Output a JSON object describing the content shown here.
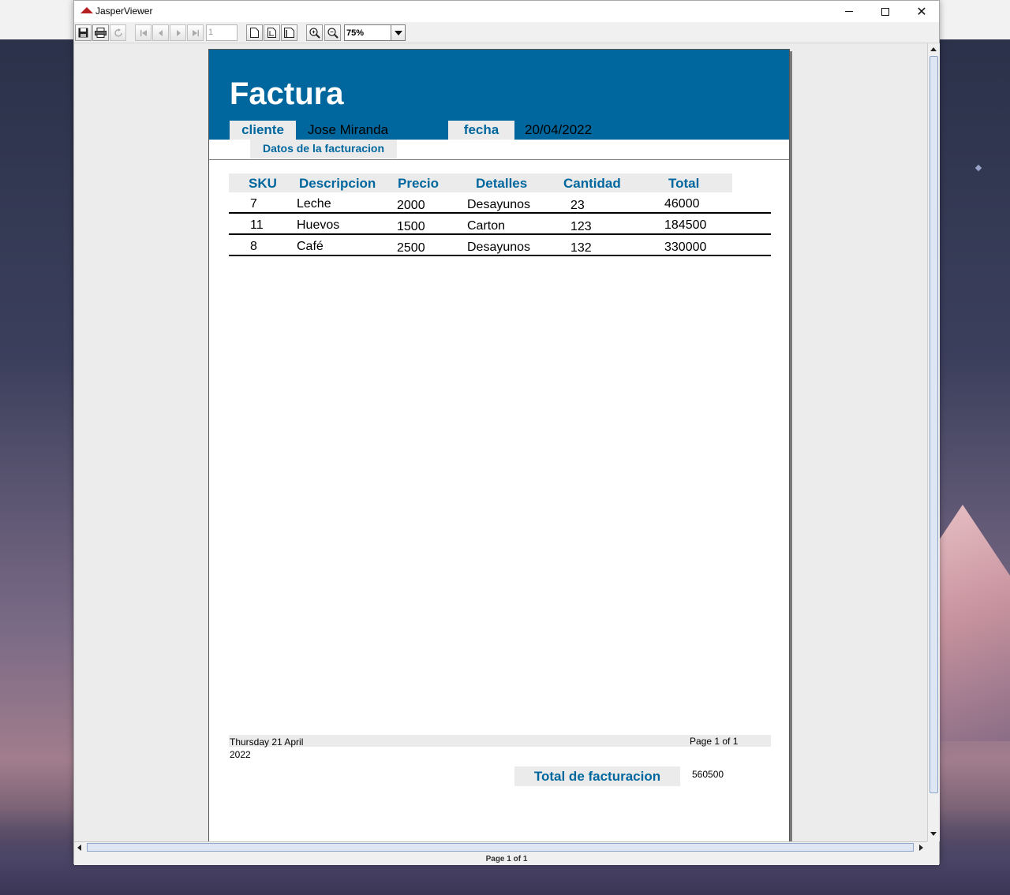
{
  "window": {
    "title": "JasperViewer",
    "minimize_glyph": "—",
    "close_glyph": "✕"
  },
  "toolbar": {
    "page_number": "1",
    "zoom_value": "75%",
    "icons": [
      "save-icon",
      "print-icon",
      "reload-icon",
      "first-page-icon",
      "previous-page-icon",
      "next-page-icon",
      "last-page-icon",
      "actual-size-icon",
      "fit-page-icon",
      "fit-width-icon",
      "zoom-in-icon",
      "zoom-out-icon"
    ]
  },
  "report": {
    "title": "Factura",
    "client_label": "cliente",
    "client_value": "Jose Miranda",
    "fecha_label": "fecha",
    "fecha_value": "20/04/2022",
    "section_label": "Datos de la facturacion",
    "columns": [
      "SKU",
      "Descripcion",
      "Precio",
      "Detalles",
      "Cantidad",
      "Total"
    ],
    "rows": [
      [
        "7",
        "Leche",
        "2000",
        "Desayunos",
        "23",
        "46000"
      ],
      [
        "11",
        "Huevos",
        "1500",
        "Carton",
        "123",
        "184500"
      ],
      [
        "8",
        "Café",
        "2500",
        "Desayunos",
        "132",
        "330000"
      ]
    ],
    "footer_date": "Thursday 21 April 2022",
    "footer_page": "Page 1 of 1",
    "total_label": "Total de facturacion",
    "total_value": "560500"
  },
  "status": {
    "page_label": "Page 1 of 1"
  },
  "colors": {
    "accent": "#00679e",
    "label_bg": "#ebebeb"
  }
}
